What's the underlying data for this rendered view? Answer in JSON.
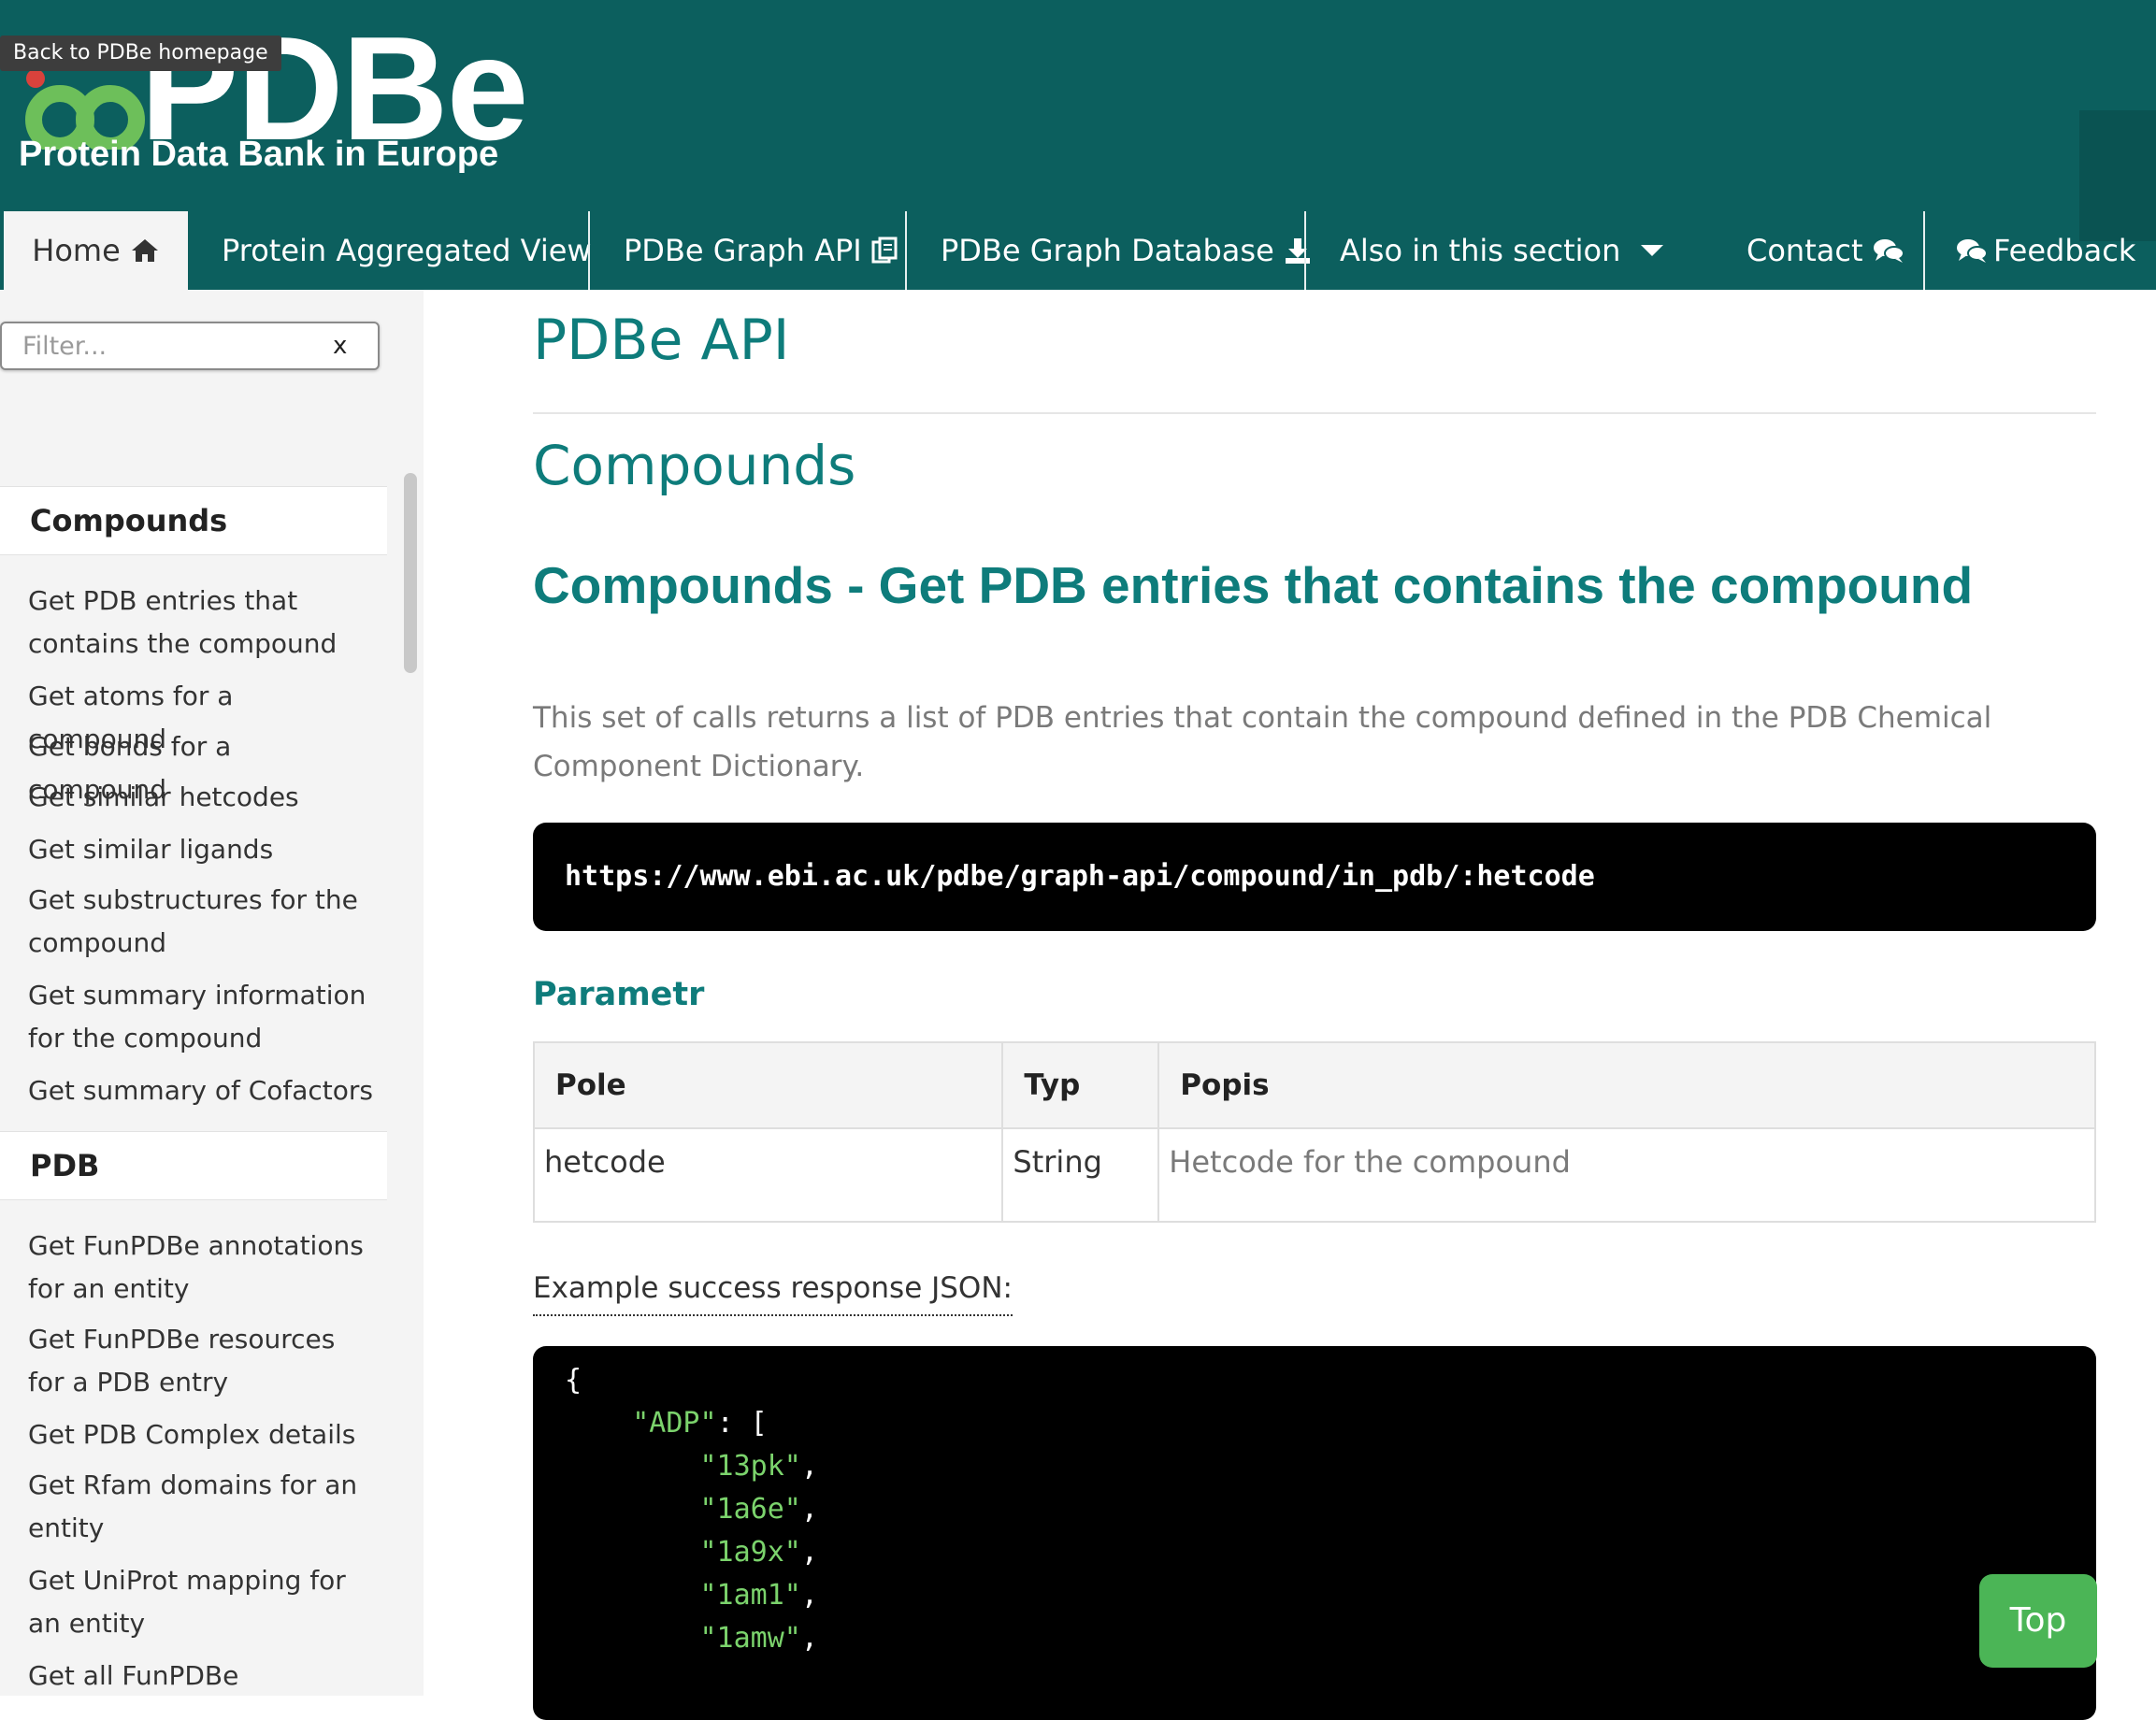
{
  "header": {
    "logo_text": "PDBe",
    "logo_subtitle": "Protein Data Bank in Europe",
    "back_tooltip": "Back to PDBe homepage"
  },
  "nav": {
    "items": [
      {
        "label": "Home",
        "icon": "home-icon"
      },
      {
        "label": "Protein Aggregated View"
      },
      {
        "label": "PDBe Graph API",
        "icon": "copy-icon"
      },
      {
        "label": "PDBe Graph Database",
        "icon": "download-icon"
      },
      {
        "label": "Also in this section",
        "icon": "caret-down-icon"
      },
      {
        "label": "Contact",
        "icon": "comments-icon"
      },
      {
        "label": "Feedback",
        "icon": "comments-icon"
      }
    ]
  },
  "sidebar": {
    "filter_placeholder": "Filter...",
    "filter_clear": "x",
    "sections": [
      {
        "title": "Compounds",
        "links": [
          "Get PDB entries that contains the compound",
          "Get atoms for a compound",
          "Get bonds for a compound",
          "Get similar hetcodes",
          "Get similar ligands",
          "Get substructures for the compound",
          "Get summary information for the compound",
          "Get summary of Cofactors"
        ]
      },
      {
        "title": "PDB",
        "links": [
          "Get FunPDBe annotations for an entity",
          "Get FunPDBe resources for a PDB entry",
          "Get PDB Complex details",
          "Get Rfam domains for an entity",
          "Get UniProt mapping for an entity",
          "Get all FunPDBe"
        ]
      }
    ]
  },
  "main": {
    "page_title": "PDBe API",
    "section_title": "Compounds",
    "endpoint_title": "Compounds - Get PDB entries that contains the compound",
    "description": "This set of calls returns a list of PDB entries that contain the compound defined in the PDB Chemical Component Dictionary.",
    "endpoint_url": "https://www.ebi.ac.uk/pdbe/graph-api/compound/in_pdb/:hetcode",
    "params_heading": "Parametr",
    "params_table": {
      "headers": [
        "Pole",
        "Typ",
        "Popis"
      ],
      "rows": [
        [
          "hetcode",
          "String",
          "Hetcode for the compound"
        ]
      ]
    },
    "example_label": "Example success response JSON:",
    "json_lines": [
      {
        "text": "{",
        "indent": 0
      },
      {
        "key": "\"ADP\"",
        "text": ": [",
        "indent": 1
      },
      {
        "str": "\"13pk\"",
        "text": ",",
        "indent": 2
      },
      {
        "str": "\"1a6e\"",
        "text": ",",
        "indent": 2
      },
      {
        "str": "\"1a9x\"",
        "text": ",",
        "indent": 2
      },
      {
        "str": "\"1am1\"",
        "text": ",",
        "indent": 2
      },
      {
        "str": "\"1amw\"",
        "text": ",",
        "indent": 2
      }
    ]
  },
  "top_button": "Top",
  "colors": {
    "header_bg": "#0c5f5e",
    "accent_teal": "#0e7c7b",
    "logo_green": "#6dbf5a",
    "top_button_green": "#4bb556",
    "json_string_green": "#7bd36c"
  }
}
